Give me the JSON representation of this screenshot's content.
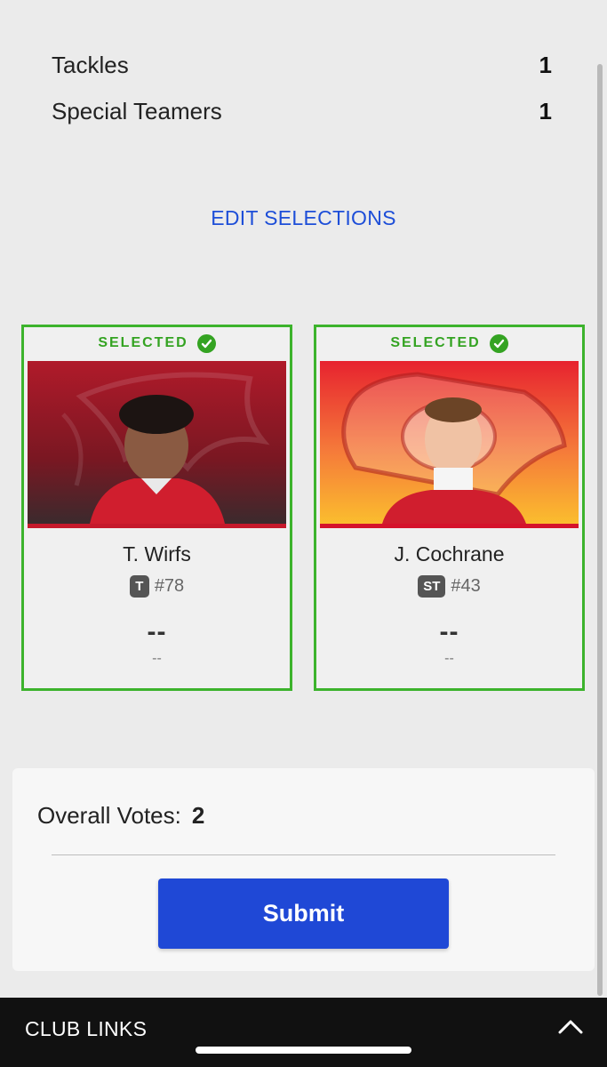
{
  "summary": {
    "rows": [
      {
        "label": "Tackles",
        "count": "1"
      },
      {
        "label": "Special Teamers",
        "count": "1"
      }
    ]
  },
  "edit_selections_label": "EDIT SELECTIONS",
  "cards": [
    {
      "status": "SELECTED",
      "name": "T. Wirfs",
      "position": "T",
      "jersey": "#78",
      "value": "--",
      "subvalue": "--",
      "team_logo": "buccaneers-flag",
      "accent": "#c6192b"
    },
    {
      "status": "SELECTED",
      "name": "J. Cochrane",
      "position": "ST",
      "jersey": "#43",
      "value": "--",
      "subvalue": "--",
      "team_logo": "chiefs-arrowhead",
      "accent": "#e7232f"
    }
  ],
  "votes": {
    "label": "Overall Votes:",
    "count": "2",
    "submit_label": "Submit"
  },
  "footer": {
    "label": "CLUB LINKS"
  },
  "colors": {
    "selected_green": "#34a322",
    "link_blue": "#1d4ed8",
    "submit_blue": "#1f48d6"
  }
}
